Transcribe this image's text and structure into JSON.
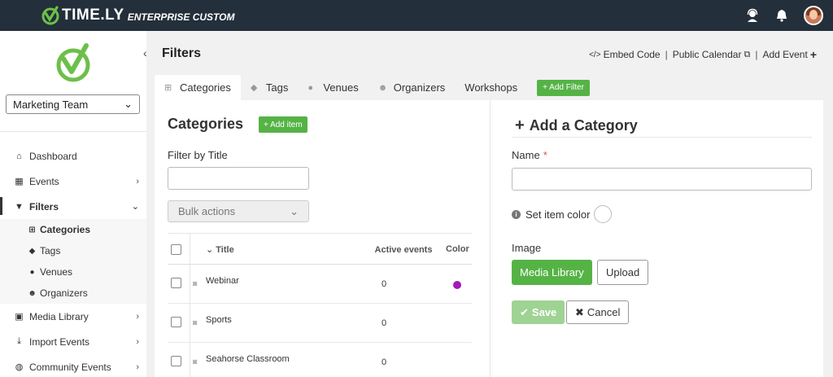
{
  "brand": {
    "name": "TIME.LY",
    "edition": "ENTERPRISE CUSTOM",
    "accent": "#6cc04a",
    "bar_color": "#232f3a"
  },
  "sidebar": {
    "team_select": "Marketing Team",
    "items": [
      {
        "label": "Dashboard",
        "icon": "home-icon"
      },
      {
        "label": "Events",
        "icon": "calendar-icon"
      },
      {
        "label": "Filters",
        "icon": "filter-icon"
      },
      {
        "label": "Media Library",
        "icon": "image-icon"
      },
      {
        "label": "Import Events",
        "icon": "download-icon"
      },
      {
        "label": "Community Events",
        "icon": "globe-icon"
      }
    ],
    "sub_items": [
      {
        "label": "Categories",
        "icon": "sitemap-icon"
      },
      {
        "label": "Tags",
        "icon": "tags-icon"
      },
      {
        "label": "Venues",
        "icon": "map-pin-icon"
      },
      {
        "label": "Organizers",
        "icon": "users-icon"
      }
    ]
  },
  "header": {
    "title": "Filters",
    "embed_code": "Embed Code",
    "public_calendar": "Public Calendar",
    "add_event": "Add Event",
    "separator": "|"
  },
  "tabs": {
    "items": [
      {
        "label": "Categories",
        "icon": "sitemap-icon"
      },
      {
        "label": "Tags",
        "icon": "tags-icon"
      },
      {
        "label": "Venues",
        "icon": "map-pin-icon"
      },
      {
        "label": "Organizers",
        "icon": "users-icon"
      },
      {
        "label": "Workshops"
      }
    ],
    "add_filter": "+ Add Filter"
  },
  "list": {
    "title": "Categories",
    "add_item": "+ Add item",
    "filter_label": "Filter by Title",
    "filter_value": "",
    "bulk_actions": "Bulk actions",
    "columns": {
      "title": "Title",
      "active_events": "Active events",
      "color": "Color"
    },
    "rows": [
      {
        "title": "Webinar",
        "active_events": "0",
        "color": "#a319b8"
      },
      {
        "title": "Sports",
        "active_events": "0",
        "color": ""
      },
      {
        "title": "Seahorse Classroom",
        "active_events": "0",
        "color": ""
      }
    ]
  },
  "form": {
    "title": "Add a Category",
    "name_label": "Name",
    "required_mark": "*",
    "name_value": "",
    "set_color": "Set item color",
    "image_label": "Image",
    "media_library": "Media Library",
    "upload": "Upload",
    "save": "Save",
    "cancel": "Cancel"
  }
}
